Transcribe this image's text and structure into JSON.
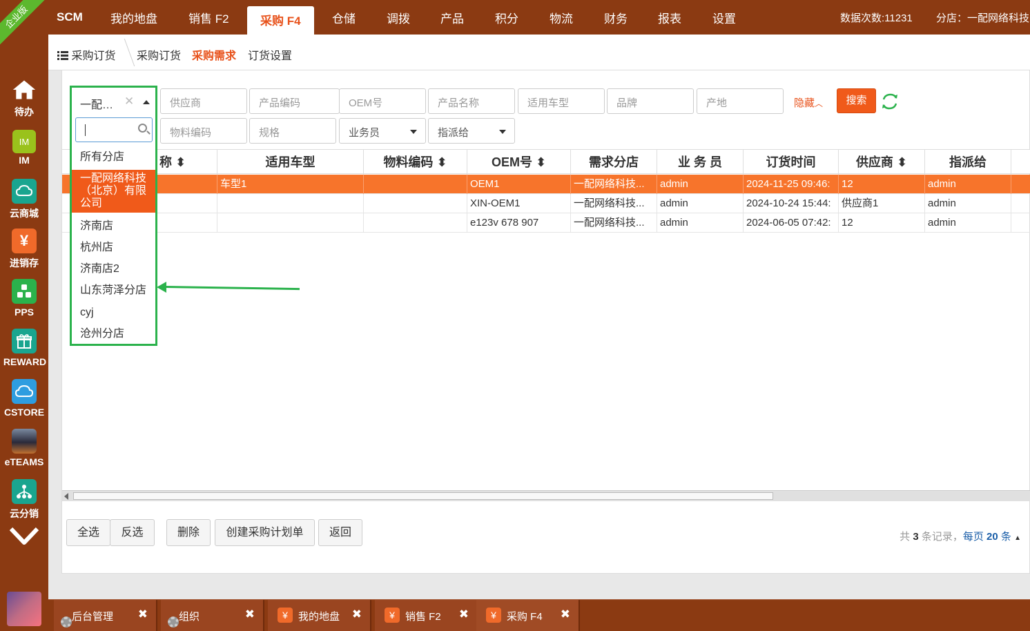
{
  "sidebar": {
    "ribbon": "企业版",
    "items": [
      {
        "label": "待办",
        "icon": "home-icon",
        "color": "#8b3a12"
      },
      {
        "label": "IM",
        "icon": "im-icon",
        "color": "#9ac21c"
      },
      {
        "label": "云商城",
        "icon": "cloud-shop-icon",
        "color": "#1aa58f"
      },
      {
        "label": "进销存",
        "icon": "yen-icon",
        "color": "#f06a2a"
      },
      {
        "label": "PPS",
        "icon": "pps-icon",
        "color": "#2bb24c"
      },
      {
        "label": "REWARD",
        "icon": "gift-icon",
        "color": "#1aa58f"
      },
      {
        "label": "CSTORE",
        "icon": "cloud-icon",
        "color": "#2e9de0"
      },
      {
        "label": "eTEAMS",
        "icon": "eteams-icon",
        "color": "#445566"
      },
      {
        "label": "云分销",
        "icon": "distribution-icon",
        "color": "#1aa58f"
      }
    ],
    "more_icon": "chevron-down-icon"
  },
  "topnav": {
    "logo": "SCM",
    "items": [
      "我的地盘",
      "销售 F2",
      "采购 F4",
      "仓储",
      "调拨",
      "产品",
      "积分",
      "物流",
      "财务",
      "报表",
      "设置"
    ],
    "active": "采购 F4",
    "data_count": "数据次数:11231",
    "branch": "分店：一配网络科技"
  },
  "subnav": {
    "menu_label": "采购订货",
    "tabs": [
      "采购订货",
      "采购需求",
      "订货设置"
    ],
    "active": "采购需求"
  },
  "filters": {
    "branch_select": "一配…",
    "placeholders": {
      "supplier": "供应商",
      "product_code": "产品编码",
      "oem": "OEM号",
      "product_name": "产品名称",
      "vehicle": "适用车型",
      "brand": "品牌",
      "origin": "产地",
      "material_code": "物料编码",
      "spec": "规格",
      "salesman": "业务员",
      "assignee": "指派给"
    },
    "hide_label": "隐藏",
    "search_label": "搜索"
  },
  "dropdown": {
    "options": [
      "所有分店",
      "一配网络科技（北京）有限公司",
      "济南店",
      "杭州店",
      "济南店2",
      "山东菏泽分店",
      "cyj",
      "沧州分店"
    ],
    "selected": "一配网络科技（北京）有限公司"
  },
  "table": {
    "headers": [
      "称",
      "适用车型",
      "物料编码",
      "OEM号",
      "需求分店",
      "业 务 员",
      "订货时间",
      "供应商",
      "指派给"
    ],
    "rows": [
      {
        "vehicle": "车型1",
        "material": "",
        "oem": "OEM1",
        "branch": "一配网络科技...",
        "salesman": "admin",
        "time": "2024-11-25 09:46:",
        "supplier": "12",
        "assignee": "admin",
        "highlight": true
      },
      {
        "vehicle": "",
        "material": "",
        "oem": "XIN-OEM1",
        "branch": "一配网络科技...",
        "salesman": "admin",
        "time": "2024-10-24 15:44:",
        "supplier": "供应商1",
        "assignee": "admin",
        "highlight": false
      },
      {
        "vehicle": "",
        "material": "",
        "oem": "e123v 678 907",
        "branch": "一配网络科技...",
        "salesman": "admin",
        "time": "2024-06-05 07:42:",
        "supplier": "12",
        "assignee": "admin",
        "highlight": false
      }
    ]
  },
  "actions": {
    "select_all": "全选",
    "invert": "反选",
    "delete": "删除",
    "create_plan": "创建采购计划单",
    "back": "返回"
  },
  "pager": {
    "prefix": "共",
    "total": "3",
    "suffix": "条记录，",
    "per_page_prefix": "每页",
    "per_page": "20",
    "per_page_suffix": "条"
  },
  "taskbar": {
    "tasks": [
      {
        "label": "后台管理",
        "icon": "gear-icon"
      },
      {
        "label": "组织",
        "icon": "gear-icon"
      },
      {
        "label": "我的地盘",
        "icon": "yen-icon"
      },
      {
        "label": "销售 F2",
        "icon": "yen-icon"
      },
      {
        "label": "采购 F4",
        "icon": "yen-icon"
      }
    ],
    "close_glyph": "✖"
  },
  "colors": {
    "brand": "#8b3a12",
    "accent": "#f05a1a",
    "highlight_row": "#f7742b",
    "annotation": "#2bb24c"
  }
}
